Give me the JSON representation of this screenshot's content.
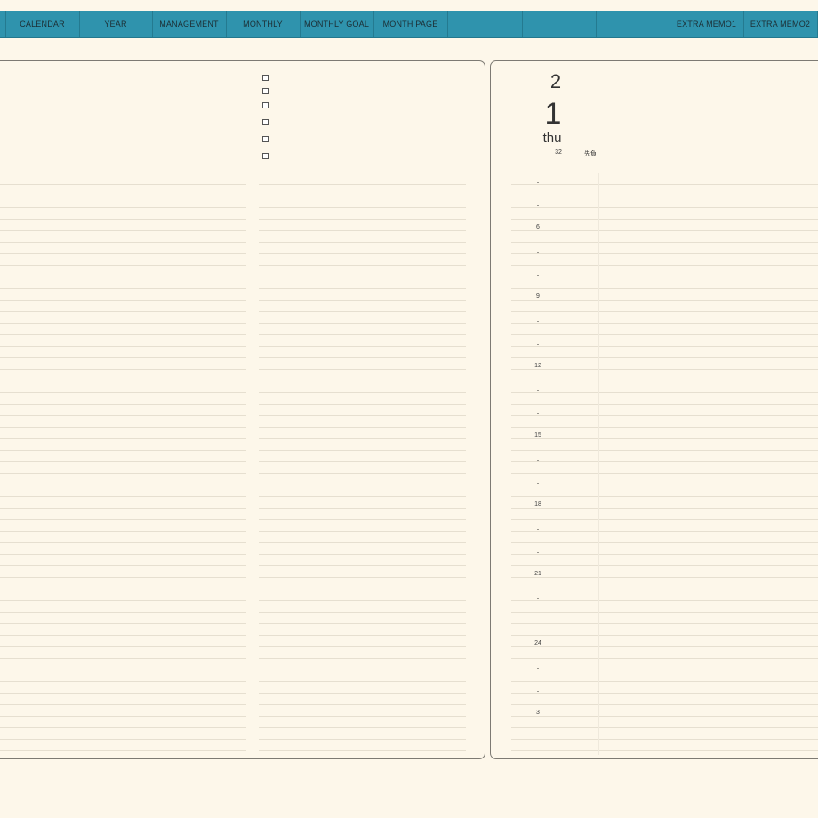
{
  "nav": {
    "tabs": [
      {
        "label": ""
      },
      {
        "label": "CALENDAR"
      },
      {
        "label": "YEAR"
      },
      {
        "label": "MANAGEMENT"
      },
      {
        "label": "MONTHLY"
      },
      {
        "label": "MONTHLY GOAL"
      },
      {
        "label": "MONTH PAGE"
      },
      {
        "label": ""
      },
      {
        "label": ""
      },
      {
        "label": ""
      },
      {
        "label": "EXTRA MEMO1"
      },
      {
        "label": "EXTRA MEMO2"
      }
    ]
  },
  "day": {
    "month": "2",
    "date": "1",
    "weekday": "thu",
    "week_number": "32",
    "note": "先負"
  },
  "schedule": {
    "hours": [
      "",
      "",
      "6",
      "",
      "",
      "9",
      "",
      "",
      "12",
      "",
      "",
      "15",
      "",
      "",
      "18",
      "",
      "",
      "21",
      "",
      "",
      "24",
      "",
      "",
      "3"
    ]
  },
  "todo": {
    "count": 6
  },
  "colors": {
    "nav": "#2f93ad",
    "background": "#fdf7ea",
    "line": "#e6dfd0"
  }
}
